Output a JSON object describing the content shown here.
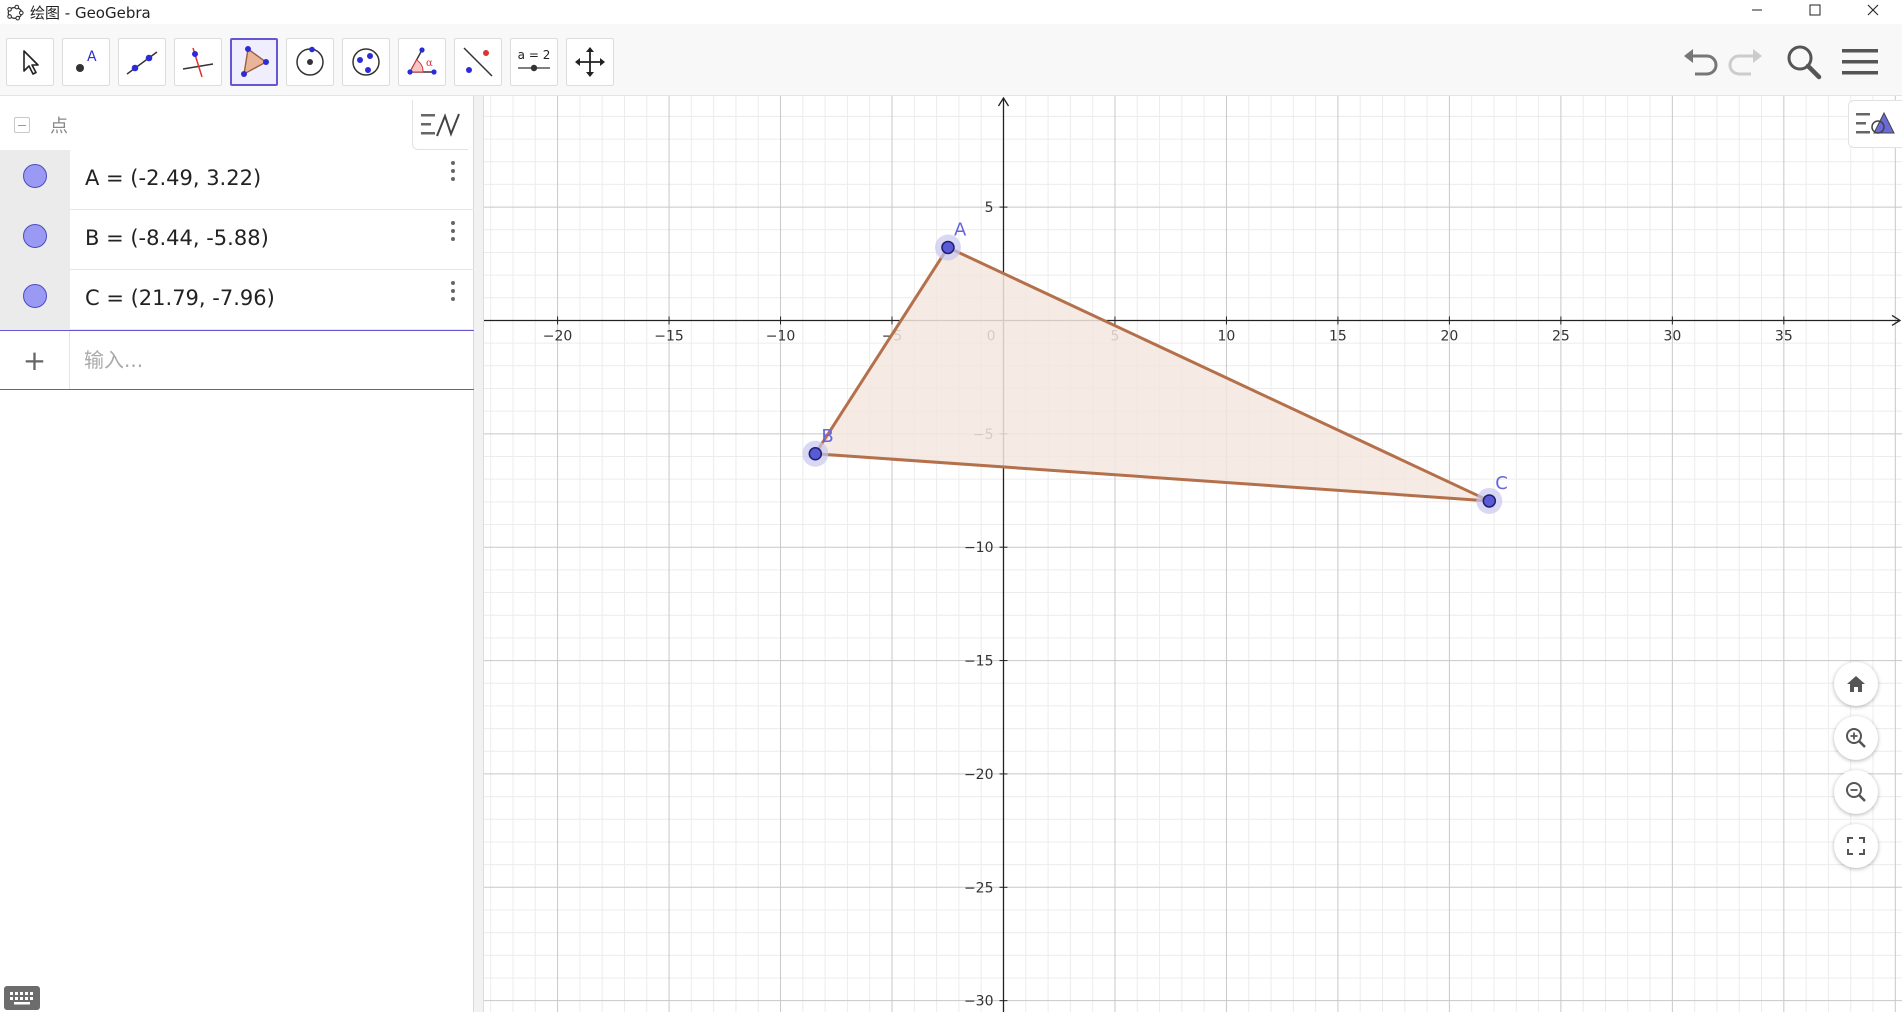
{
  "window": {
    "title": "绘图 - GeoGebra"
  },
  "toolbar": {
    "tools": [
      {
        "icon": "move-arrow-icon",
        "active": false
      },
      {
        "icon": "point-icon",
        "active": false
      },
      {
        "icon": "line-icon",
        "active": false
      },
      {
        "icon": "perpendicular-line-icon",
        "active": false
      },
      {
        "icon": "polygon-icon",
        "active": true
      },
      {
        "icon": "circle-center-point-icon",
        "active": false
      },
      {
        "icon": "circle-three-points-icon",
        "active": false
      },
      {
        "icon": "angle-icon",
        "active": false
      },
      {
        "icon": "reflect-icon",
        "active": false
      },
      {
        "icon": "slider-icon",
        "active": false,
        "label": "a = 2"
      },
      {
        "icon": "move-graphics-icon",
        "active": false
      }
    ],
    "right": [
      "undo-icon",
      "redo-icon",
      "search-icon",
      "menu-icon"
    ]
  },
  "algebra": {
    "group_label": "点",
    "items": [
      {
        "name": "A",
        "text": "A = (-2.49, 3.22)"
      },
      {
        "name": "B",
        "text": "B = (-8.44, -5.88)"
      },
      {
        "name": "C",
        "text": "C = (21.79, -7.96)"
      }
    ],
    "input_placeholder": "输入..."
  },
  "graphics": {
    "points": [
      {
        "label": "A",
        "x": -2.49,
        "y": 3.22
      },
      {
        "label": "B",
        "x": -8.44,
        "y": -5.88
      },
      {
        "label": "C",
        "x": 21.79,
        "y": -7.96
      }
    ],
    "x_ticks": [
      -20,
      -15,
      -10,
      -5,
      0,
      5,
      10,
      15,
      20,
      25,
      30,
      35
    ],
    "y_ticks": [
      5,
      -5,
      -10,
      -15,
      -20,
      -25,
      -30
    ],
    "x_range": [
      -23.3,
      40.3
    ],
    "y_range": [
      -30.5,
      9.9
    ],
    "colors": {
      "polygon_fill": "#f3e6df",
      "polygon_stroke": "#b4704a",
      "point_fill": "#5a5ad6",
      "point_halo": "#c8c8f0",
      "point_label": "#6565e0",
      "axis": "#222222",
      "grid_major": "#c8c8c8",
      "grid_minor": "#ececec",
      "accent": "#6557d2"
    }
  }
}
